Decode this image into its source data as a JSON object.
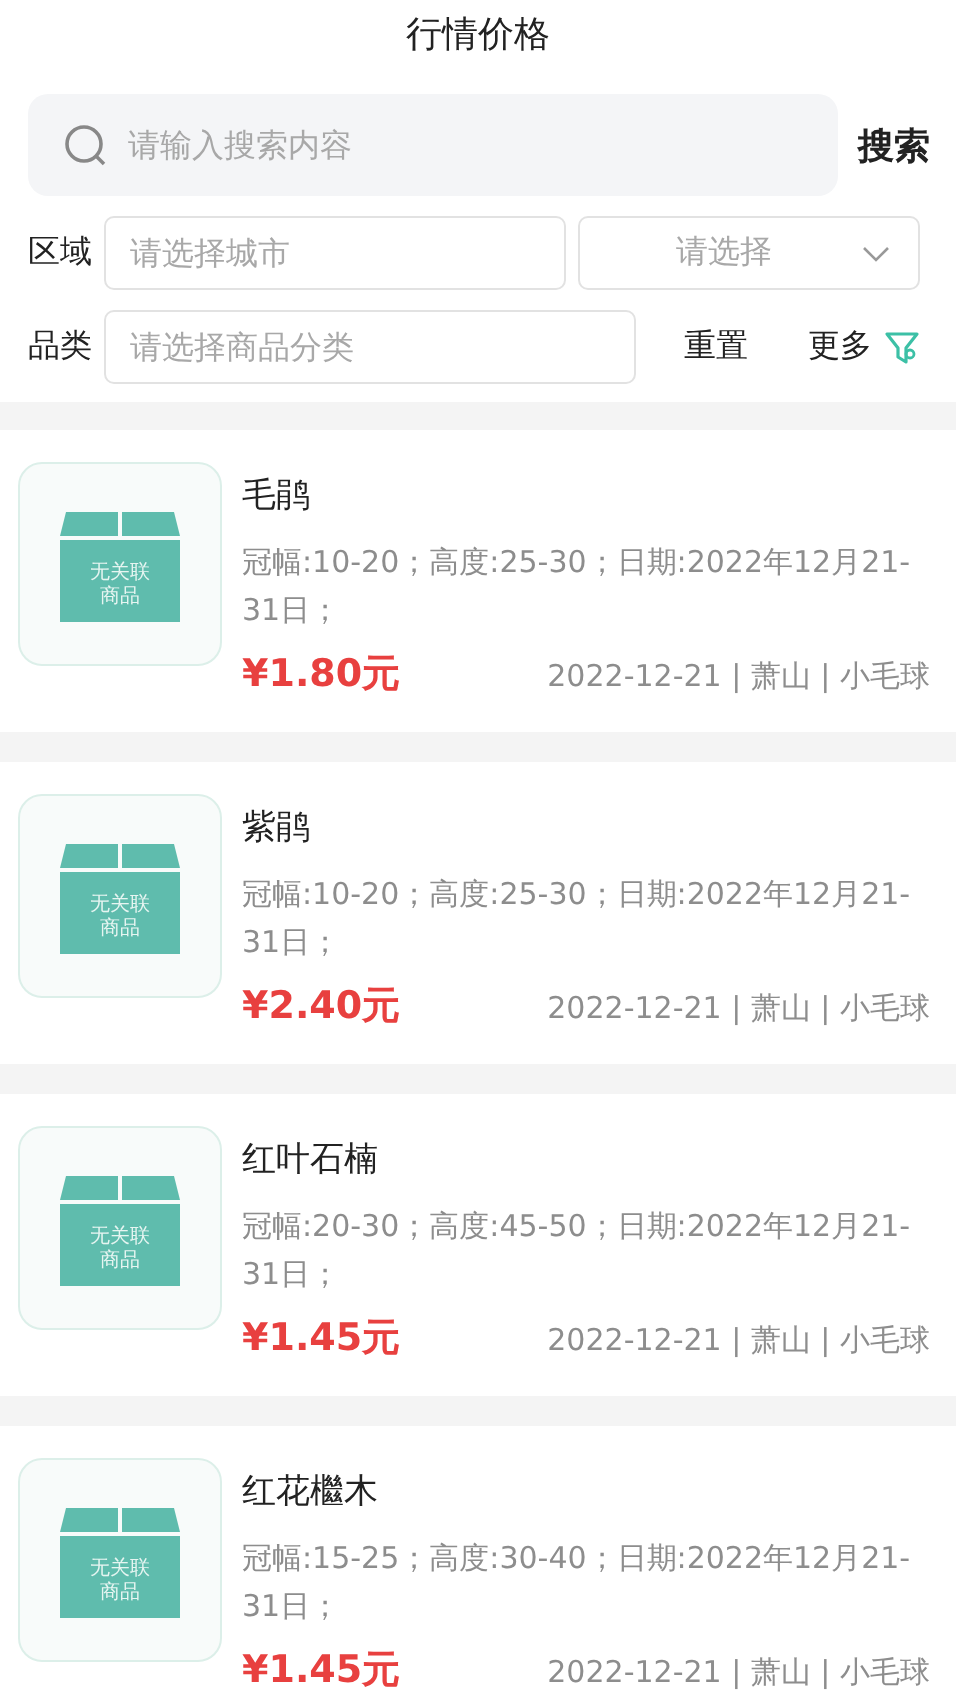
{
  "title": "行情价格",
  "search": {
    "placeholder": "请输入搜索内容",
    "button": "搜索"
  },
  "filters": {
    "region_label": "区域",
    "city_placeholder": "请选择城市",
    "select_placeholder": "请选择",
    "category_label": "品类",
    "category_placeholder": "请选择商品分类",
    "reset": "重置",
    "more": "更多"
  },
  "items": [
    {
      "image_lines": [
        "无关联",
        "商品"
      ],
      "name": "毛鹃",
      "desc": "冠幅:10-20；高度:25-30；日期:2022年12月21-31日；",
      "price": "¥1.80元",
      "meta": "2022-12-21 | 萧山 | 小毛球"
    },
    {
      "image_lines": [
        "无关联",
        "商品"
      ],
      "name": "紫鹃",
      "desc": "冠幅:10-20；高度:25-30；日期:2022年12月21-31日；",
      "price": "¥2.40元",
      "meta": "2022-12-21 | 萧山 | 小毛球"
    },
    {
      "image_lines": [
        "无关联",
        "商品"
      ],
      "name": "红叶石楠",
      "desc": "冠幅:20-30；高度:45-50；日期:2022年12月21-31日；",
      "price": "¥1.45元",
      "meta": "2022-12-21 | 萧山 | 小毛球"
    },
    {
      "image_lines": [
        "无关联",
        "商品"
      ],
      "name": "红花檵木",
      "desc": "冠幅:15-25；高度:30-40；日期:2022年12月21-31日；",
      "price": "¥1.45元",
      "meta": "2022-12-21 | 萧山 | 小毛球"
    }
  ]
}
